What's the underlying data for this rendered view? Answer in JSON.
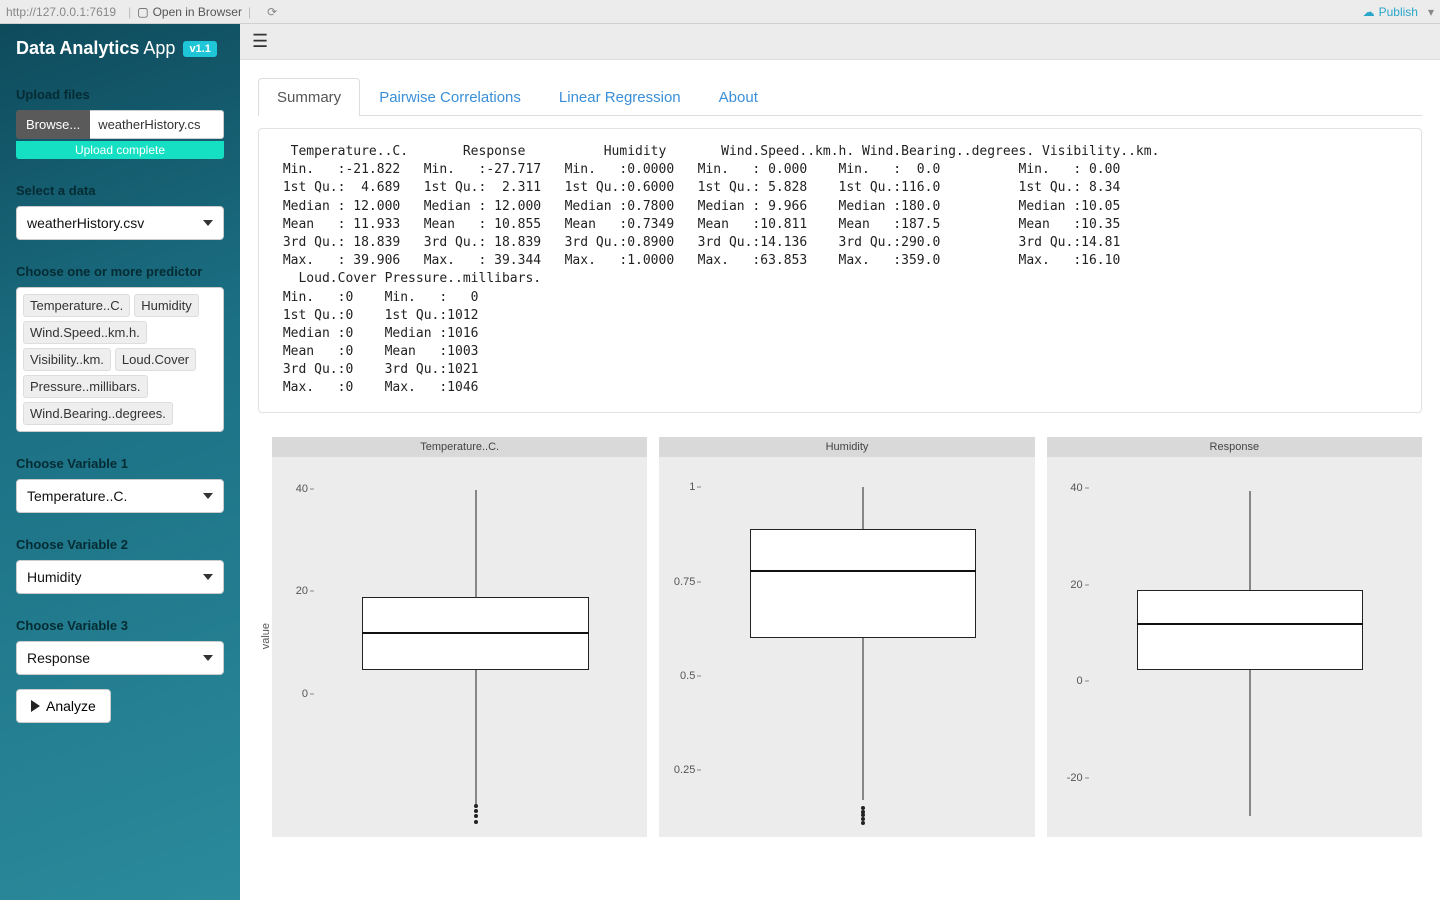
{
  "topbar": {
    "url": "http://127.0.0.1:7619",
    "open_browser": "Open in Browser",
    "publish": "Publish"
  },
  "brand": {
    "bold": "Data Analytics",
    "light": "App",
    "version": "v1.1"
  },
  "sidebar": {
    "upload_label": "Upload files",
    "browse_label": "Browse...",
    "file_name": "weatherHistory.cs",
    "progress_text": "Upload complete",
    "select_data_label": "Select a data",
    "select_data_value": "weatherHistory.csv",
    "predictor_label": "Choose one or more predictor",
    "predictors": [
      "Temperature..C.",
      "Humidity",
      "Wind.Speed..km.h.",
      "Visibility..km.",
      "Loud.Cover",
      "Pressure..millibars.",
      "Wind.Bearing..degrees."
    ],
    "var1_label": "Choose Variable 1",
    "var1_value": "Temperature..C.",
    "var2_label": "Choose Variable 2",
    "var2_value": "Humidity",
    "var3_label": "Choose Variable 3",
    "var3_value": "Response",
    "analyze_label": "Analyze"
  },
  "tabs": [
    "Summary",
    "Pairwise Correlations",
    "Linear Regression",
    "About"
  ],
  "summary_text": "  Temperature..C.       Response          Humidity       Wind.Speed..km.h. Wind.Bearing..degrees. Visibility..km.\n Min.   :-21.822   Min.   :-27.717   Min.   :0.0000   Min.   : 0.000    Min.   :  0.0          Min.   : 0.00\n 1st Qu.:  4.689   1st Qu.:  2.311   1st Qu.:0.6000   1st Qu.: 5.828    1st Qu.:116.0          1st Qu.: 8.34\n Median : 12.000   Median : 12.000   Median :0.7800   Median : 9.966    Median :180.0          Median :10.05\n Mean   : 11.933   Mean   : 10.855   Mean   :0.7349   Mean   :10.811    Mean   :187.5          Mean   :10.35\n 3rd Qu.: 18.839   3rd Qu.: 18.839   3rd Qu.:0.8900   3rd Qu.:14.136    3rd Qu.:290.0          3rd Qu.:14.81\n Max.   : 39.906   Max.   : 39.344   Max.   :1.0000   Max.   :63.853    Max.   :359.0          Max.   :16.10\n   Loud.Cover Pressure..millibars.\n Min.   :0    Min.   :   0\n 1st Qu.:0    1st Qu.:1012\n Median :0    Median :1016\n Mean   :0    Mean   :1003\n 3rd Qu.:0    3rd Qu.:1021\n Max.   :0    Max.   :1046",
  "charts_ylabel": "value",
  "chart_data": [
    {
      "type": "boxplot",
      "title": "Temperature..C.",
      "yticks": [
        0,
        20,
        40
      ],
      "ymin": -26,
      "ymax": 44,
      "min": -21.822,
      "q1": 4.689,
      "median": 12.0,
      "q3": 18.839,
      "max": 39.906,
      "outliers": [
        -22,
        -23,
        -24,
        -25
      ]
    },
    {
      "type": "boxplot",
      "title": "Humidity",
      "yticks": [
        0.25,
        0.5,
        0.75,
        1.0
      ],
      "ymin": 0.1,
      "ymax": 1.05,
      "min": 0.17,
      "q1": 0.6,
      "median": 0.78,
      "q3": 0.89,
      "max": 1.0,
      "outliers": [
        0.15,
        0.14,
        0.13,
        0.12,
        0.11
      ]
    },
    {
      "type": "boxplot",
      "title": "Response",
      "yticks": [
        -20,
        0,
        20,
        40
      ],
      "ymin": -30,
      "ymax": 44,
      "min": -27.717,
      "q1": 2.311,
      "median": 12.0,
      "q3": 18.839,
      "max": 39.344,
      "outliers": []
    }
  ]
}
